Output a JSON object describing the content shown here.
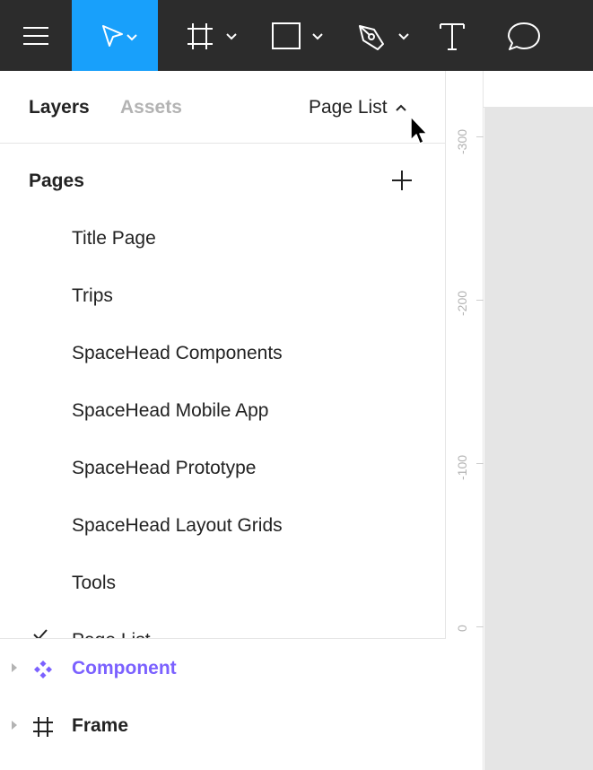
{
  "toolbar": {
    "tools": [
      {
        "name": "menu",
        "icon": "hamburger-menu-icon"
      },
      {
        "name": "move",
        "icon": "move-arrow-icon",
        "active": true
      },
      {
        "name": "frame",
        "icon": "frame-hash-icon"
      },
      {
        "name": "shape",
        "icon": "rectangle-icon"
      },
      {
        "name": "pen",
        "icon": "pen-icon"
      },
      {
        "name": "text",
        "icon": "text-icon"
      },
      {
        "name": "comment",
        "icon": "comment-bubble-icon"
      }
    ],
    "active_color": "#18a0fb",
    "background": "#2c2c2c"
  },
  "panel": {
    "tabs": {
      "layers": "Layers",
      "assets": "Assets"
    },
    "page_list_toggle": "Page List",
    "pages": {
      "header": "Pages",
      "items": [
        "Title Page",
        "Trips",
        "SpaceHead Components",
        "SpaceHead Mobile App",
        "SpaceHead Prototype",
        "SpaceHead Layout Grids",
        "Tools",
        "Page List"
      ],
      "selected": "Page List"
    },
    "layers": [
      {
        "label": "Component",
        "icon": "component-icon",
        "color": "#7b61ff"
      },
      {
        "label": "Frame",
        "icon": "frame-hash-icon",
        "color": "#222222"
      }
    ]
  },
  "ruler": {
    "labels": [
      "-300",
      "-200",
      "-100",
      "0"
    ]
  }
}
